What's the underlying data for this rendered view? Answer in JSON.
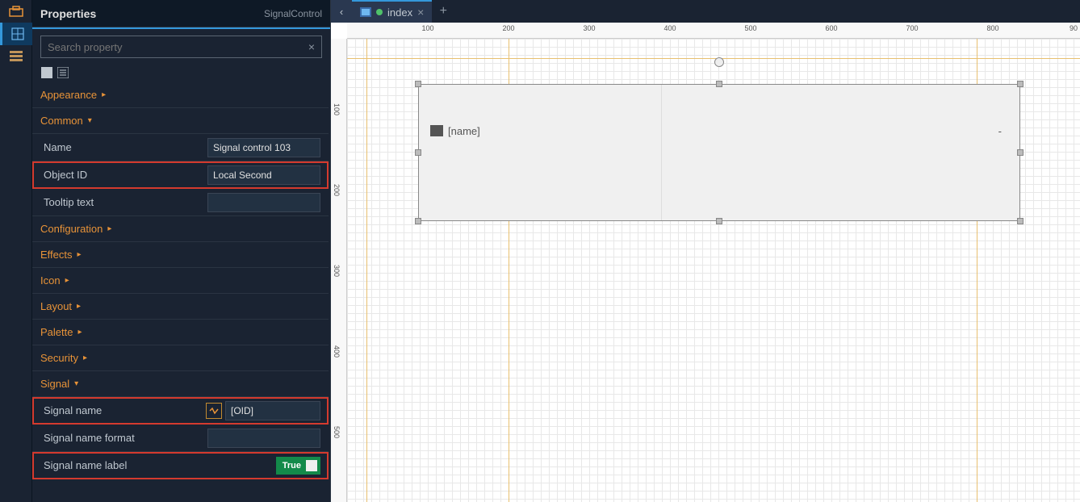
{
  "sidebar": {
    "icons": [
      "toolbox-icon",
      "grid-icon",
      "list-icon"
    ]
  },
  "properties": {
    "title": "Properties",
    "subtitle": "SignalControl",
    "search_placeholder": "Search property",
    "sections": {
      "appearance": "Appearance",
      "common": "Common",
      "configuration": "Configuration",
      "effects": "Effects",
      "icon": "Icon",
      "layout": "Layout",
      "palette": "Palette",
      "security": "Security",
      "signal": "Signal"
    },
    "common_fields": {
      "name_label": "Name",
      "name_value": "Signal control 103",
      "object_id_label": "Object ID",
      "object_id_value": "Local Second",
      "tooltip_label": "Tooltip text",
      "tooltip_value": ""
    },
    "signal_fields": {
      "signal_name_label": "Signal name",
      "signal_name_value": "[OID]",
      "signal_name_format_label": "Signal name format",
      "signal_name_format_value": "",
      "signal_name_label_label": "Signal name label",
      "signal_name_label_value": "True"
    }
  },
  "tabs": {
    "active": "index"
  },
  "ruler": {
    "h": [
      "100",
      "200",
      "300",
      "400",
      "500",
      "600",
      "700",
      "800",
      "90"
    ],
    "v": [
      "100",
      "200",
      "300",
      "400",
      "500"
    ]
  },
  "canvas": {
    "component_label_prefix": "[name]",
    "component_value": "-"
  }
}
